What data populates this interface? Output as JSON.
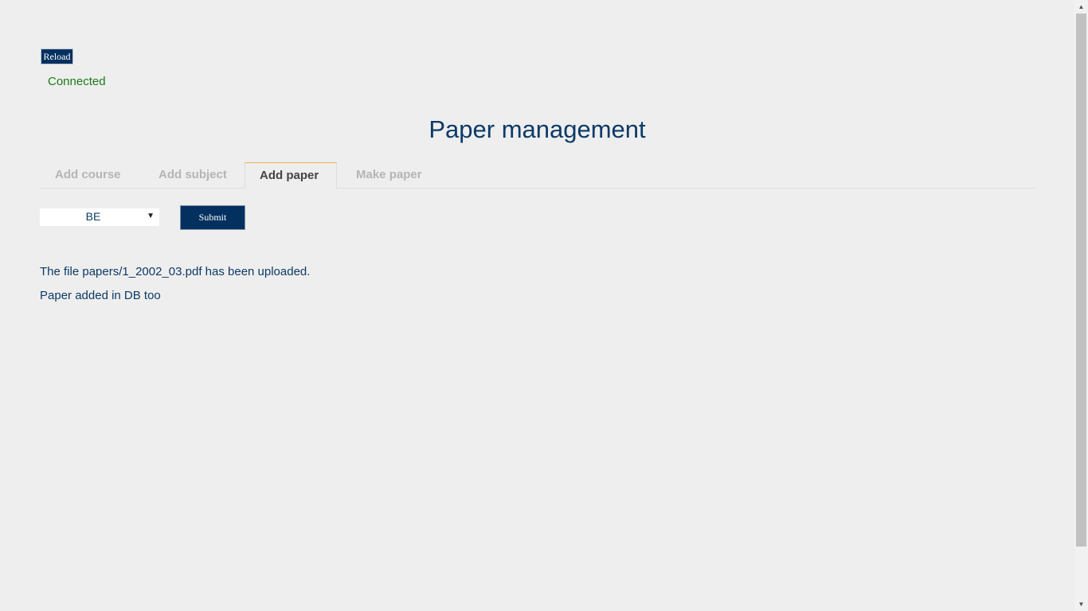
{
  "toolbar": {
    "reload_label": "Reload",
    "status_text": "Connected",
    "status_color": "#1a7a1a"
  },
  "page_title": "Paper management",
  "tabs": [
    {
      "label": "Add course",
      "icon": "tab-icon",
      "active": false
    },
    {
      "label": "Add subject",
      "icon": "tab-icon",
      "active": false
    },
    {
      "label": "Add paper",
      "icon": "tab-icon",
      "active": true
    },
    {
      "label": "Make paper",
      "icon": "tab-icon",
      "active": false
    }
  ],
  "form": {
    "course_select_value": "BE",
    "submit_label": "Submit"
  },
  "messages": [
    "The file papers/1_2002_03.pdf has been uploaded.",
    "Paper added in DB too"
  ],
  "colors": {
    "accent": "#03305f",
    "heading": "#0d3a66",
    "active_tab_border": "#f0ad4e",
    "background": "#eeeeee"
  },
  "icons": {
    "tab_icon_glyph": "",
    "select_arrow": "▼",
    "scroll_up": "▲",
    "scroll_down": "▼"
  }
}
